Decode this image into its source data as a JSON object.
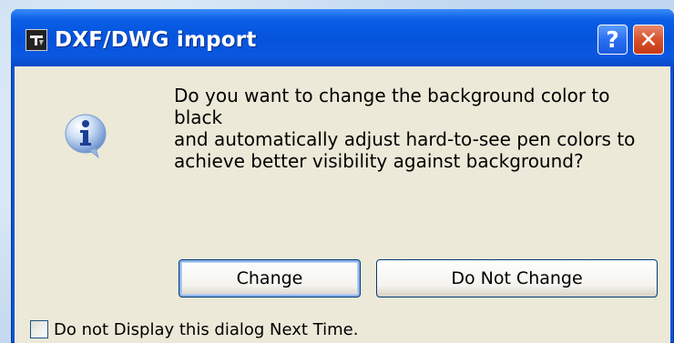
{
  "dialog": {
    "title": "DXF/DWG import",
    "help_label": "?",
    "close_label": "✕",
    "message_lines": [
      "Do you want to change the background color to black",
      "and automatically adjust hard-to-see pen colors to",
      "achieve better visibility against background?"
    ],
    "buttons": {
      "change": "Change",
      "do_not_change": "Do Not Change"
    },
    "checkbox": {
      "label": "Do not Display this dialog Next Time.",
      "checked": false
    }
  },
  "colors": {
    "titlebar": "#0a5fe6",
    "client_bg": "#ece9d8",
    "close_button": "#d8512c",
    "help_button": "#2a6ff2"
  },
  "icons": {
    "app": "app-icon",
    "info": "info-icon",
    "help": "help-icon",
    "close": "close-icon"
  }
}
